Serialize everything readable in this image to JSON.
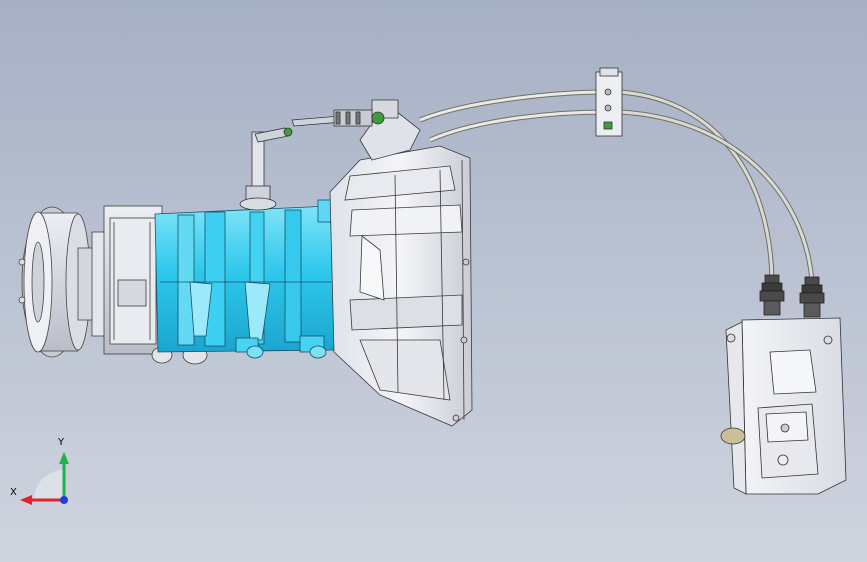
{
  "viewport": {
    "background_top": "#a6b0c4",
    "background_bottom": "#cfd4de",
    "model_name": "transmission-assembly",
    "highlight_color": "#2ec8ec"
  },
  "triad": {
    "x_label": "X",
    "y_label": "Y",
    "x_color": "#e0242c",
    "y_color": "#22b04a",
    "z_color": "#1f3fd6"
  }
}
